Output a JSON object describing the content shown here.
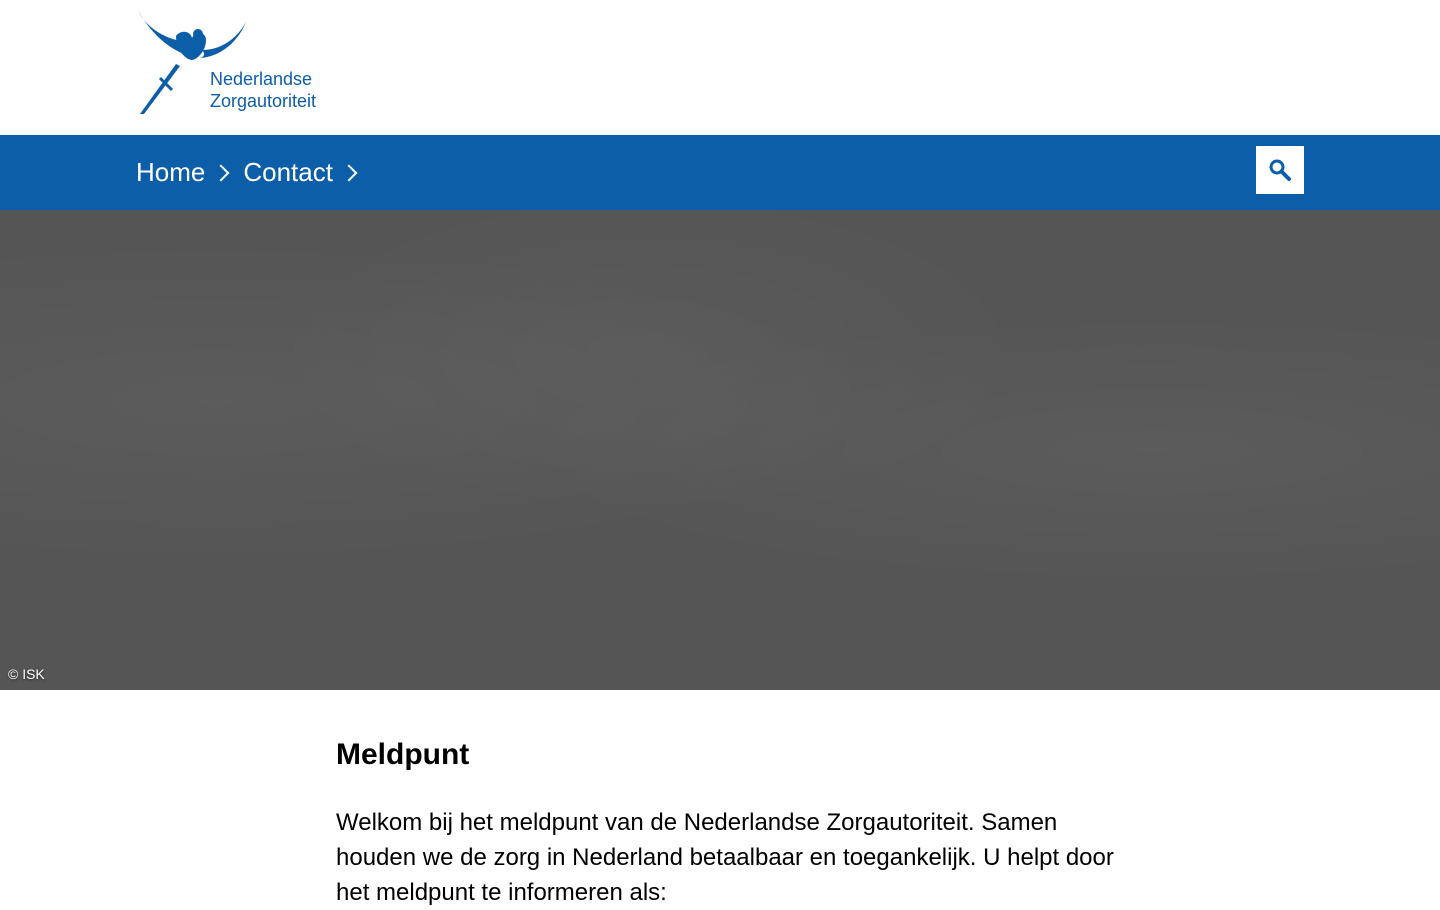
{
  "logo": {
    "line1": "Nederlandse",
    "line2": "Zorgautoriteit",
    "icon": "angel-with-sword-logo"
  },
  "nav": {
    "breadcrumb": [
      {
        "label": "Home"
      },
      {
        "label": "Contact"
      }
    ],
    "search_icon": "search-icon"
  },
  "hero": {
    "credit": "© ISK"
  },
  "main": {
    "title": "Meldpunt",
    "intro": "Welkom bij het meldpunt van de Nederlandse Zorgautoriteit. Samen houden we de zorg in Nederland betaalbaar en toegankelijk. U helpt door het meldpunt te informeren als:"
  },
  "colors": {
    "brand": "#0d5ea8",
    "hero_bg": "#555555"
  }
}
